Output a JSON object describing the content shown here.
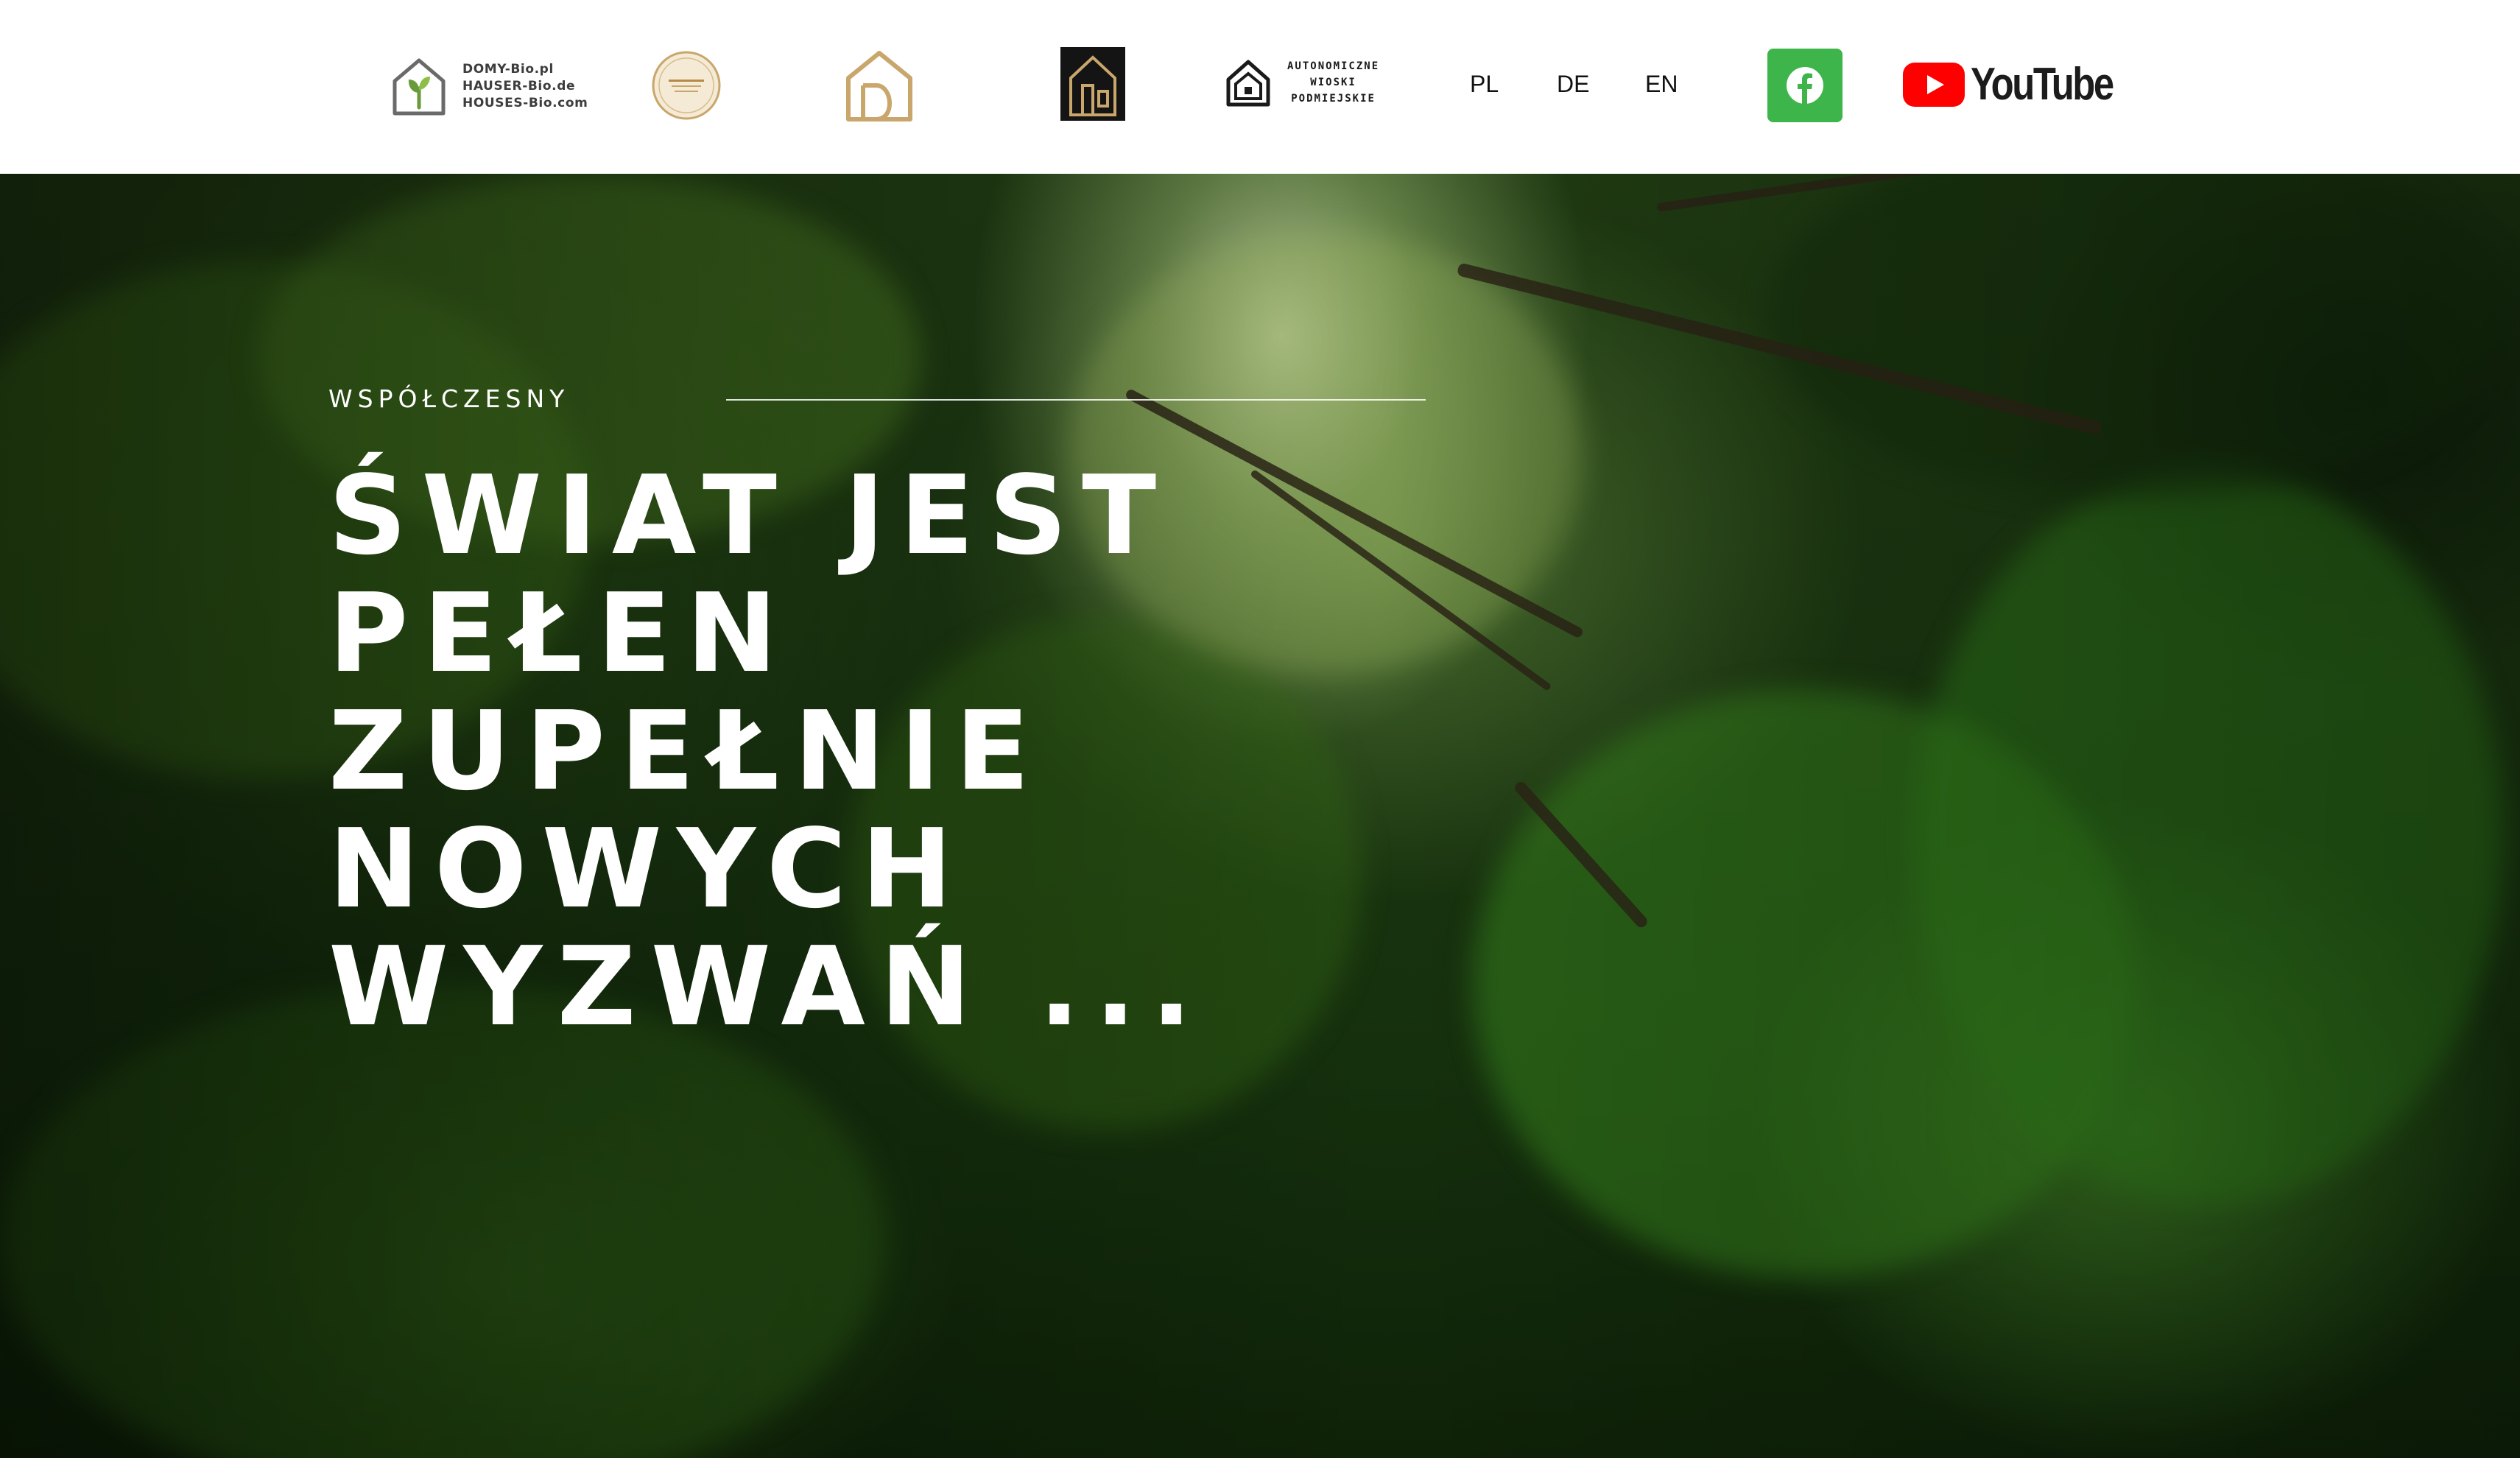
{
  "header": {
    "brand_lines": [
      "DOMY-Bio.pl",
      "HAUSER-Bio.de",
      "HOUSES-Bio.com"
    ],
    "villages_lines": [
      "AUTONOMICZNE",
      "WIOSKI",
      "PODMIEJSKIE"
    ],
    "languages": [
      {
        "label": "PL"
      },
      {
        "label": "DE"
      },
      {
        "label": "EN"
      }
    ],
    "facebook": {
      "icon": "facebook-icon",
      "color": "#3db54a"
    },
    "youtube": {
      "label": "YouTube",
      "icon": "youtube-play-icon",
      "color": "#ff0000"
    }
  },
  "hero": {
    "eyebrow": "WSPÓŁCZESNY",
    "headline_lines": [
      "ŚWIAT JEST",
      "PEŁEN",
      "ZUPEŁNIE",
      "NOWYCH",
      "WYZWAŃ ..."
    ],
    "background": "forest-canopy-photo"
  },
  "colors": {
    "accent_green": "#3db54a",
    "brand_green": "#6a9a3a",
    "ceramic_gold": "#c9a66b",
    "text_dark": "#111111"
  }
}
